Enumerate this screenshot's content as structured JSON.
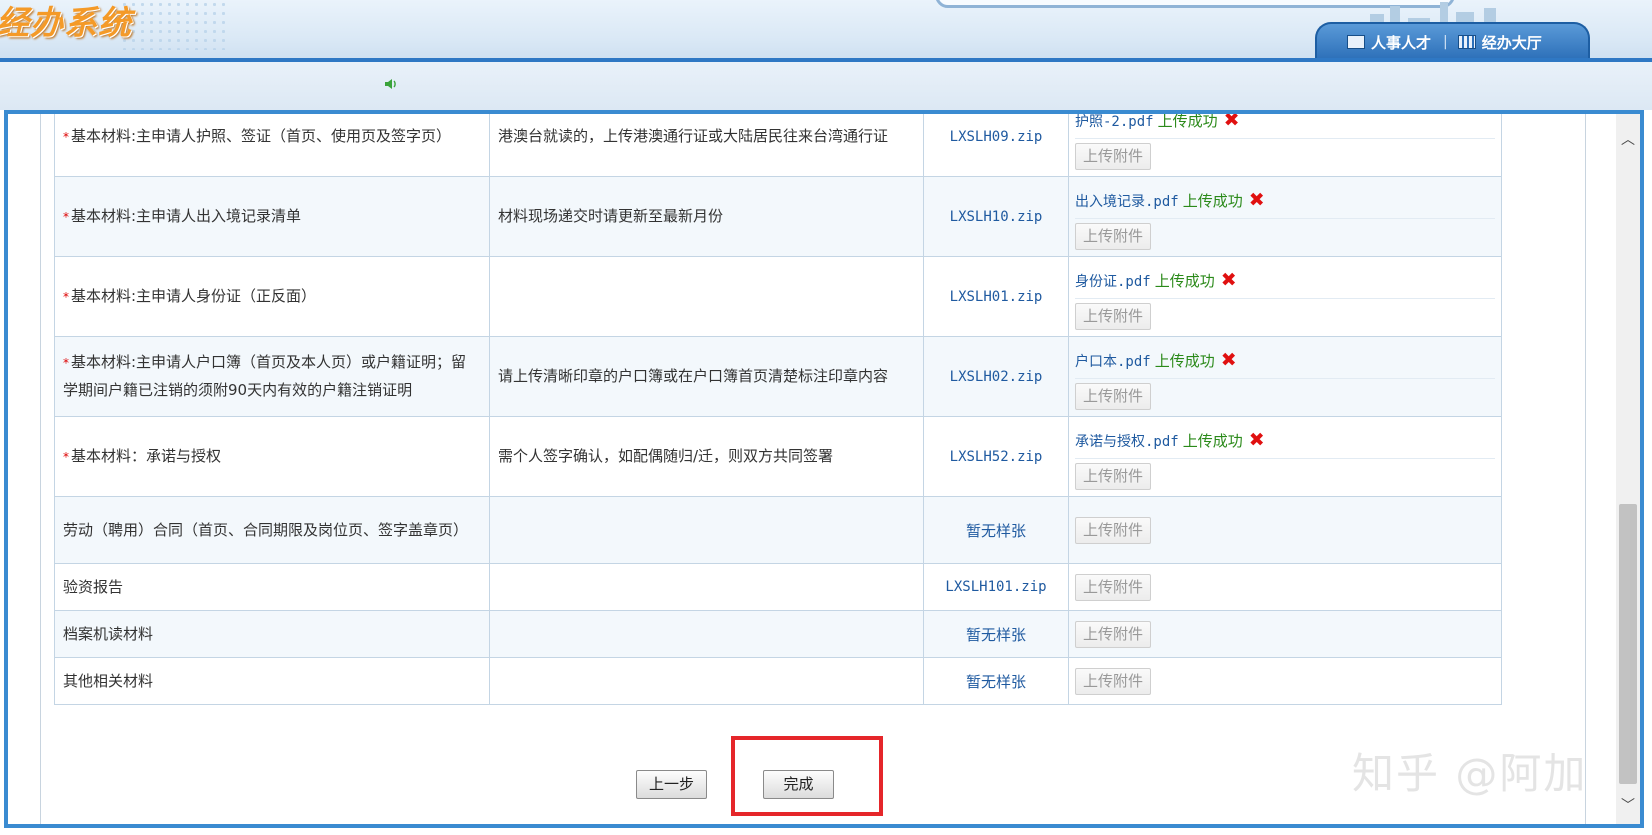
{
  "header": {
    "app_title": "经办系统",
    "nav": [
      {
        "label": "人事人才",
        "icon": "book-icon"
      },
      {
        "label": "经办大厅",
        "icon": "building-icon"
      }
    ]
  },
  "materials": [
    {
      "required": true,
      "name": "基本材料:主申请人护照、签证（首页、使用页及签字页）",
      "desc": "港澳台就读的，上传港澳通行证或大陆居民往来台湾通行证",
      "sample": "LXSLH09.zip",
      "file": "护照-2.pdf",
      "status": "上传成功",
      "upload_label": "上传附件"
    },
    {
      "required": true,
      "name": "基本材料:主申请人出入境记录清单",
      "desc": "材料现场递交时请更新至最新月份",
      "sample": "LXSLH10.zip",
      "file": "出入境记录.pdf",
      "status": "上传成功",
      "upload_label": "上传附件"
    },
    {
      "required": true,
      "name": "基本材料:主申请人身份证（正反面）",
      "desc": "",
      "sample": "LXSLH01.zip",
      "file": "身份证.pdf",
      "status": "上传成功",
      "upload_label": "上传附件"
    },
    {
      "required": true,
      "name": "基本材料:主申请人户口簿（首页及本人页）或户籍证明；留学期间户籍已注销的须附90天内有效的户籍注销证明",
      "desc": "请上传清晰印章的户口簿或在户口簿首页清楚标注印章内容",
      "sample": "LXSLH02.zip",
      "file": "户口本.pdf",
      "status": "上传成功",
      "upload_label": "上传附件"
    },
    {
      "required": true,
      "name": "基本材料：承诺与授权",
      "desc": "需个人签字确认，如配偶随归/迁，则双方共同签署",
      "sample": "LXSLH52.zip",
      "file": "承诺与授权.pdf",
      "status": "上传成功",
      "upload_label": "上传附件"
    },
    {
      "required": false,
      "name": "劳动（聘用）合同（首页、合同期限及岗位页、签字盖章页）",
      "desc": "",
      "sample": "暂无样张",
      "upload_label": "上传附件"
    },
    {
      "required": false,
      "name": "验资报告",
      "desc": "",
      "sample": "LXSLH101.zip",
      "upload_label": "上传附件"
    },
    {
      "required": false,
      "name": "档案机读材料",
      "desc": "",
      "sample": "暂无样张",
      "upload_label": "上传附件"
    },
    {
      "required": false,
      "name": "其他相关材料",
      "desc": "",
      "sample": "暂无样张",
      "upload_label": "上传附件"
    }
  ],
  "footer": {
    "prev_label": "上一步",
    "finish_label": "完成"
  },
  "watermark": "知乎 @阿加",
  "colors": {
    "accent": "#3a8bd1",
    "success": "#2b8a1a",
    "delete": "#e01010",
    "highlight": "#e5262a",
    "title": "#f49a28"
  }
}
